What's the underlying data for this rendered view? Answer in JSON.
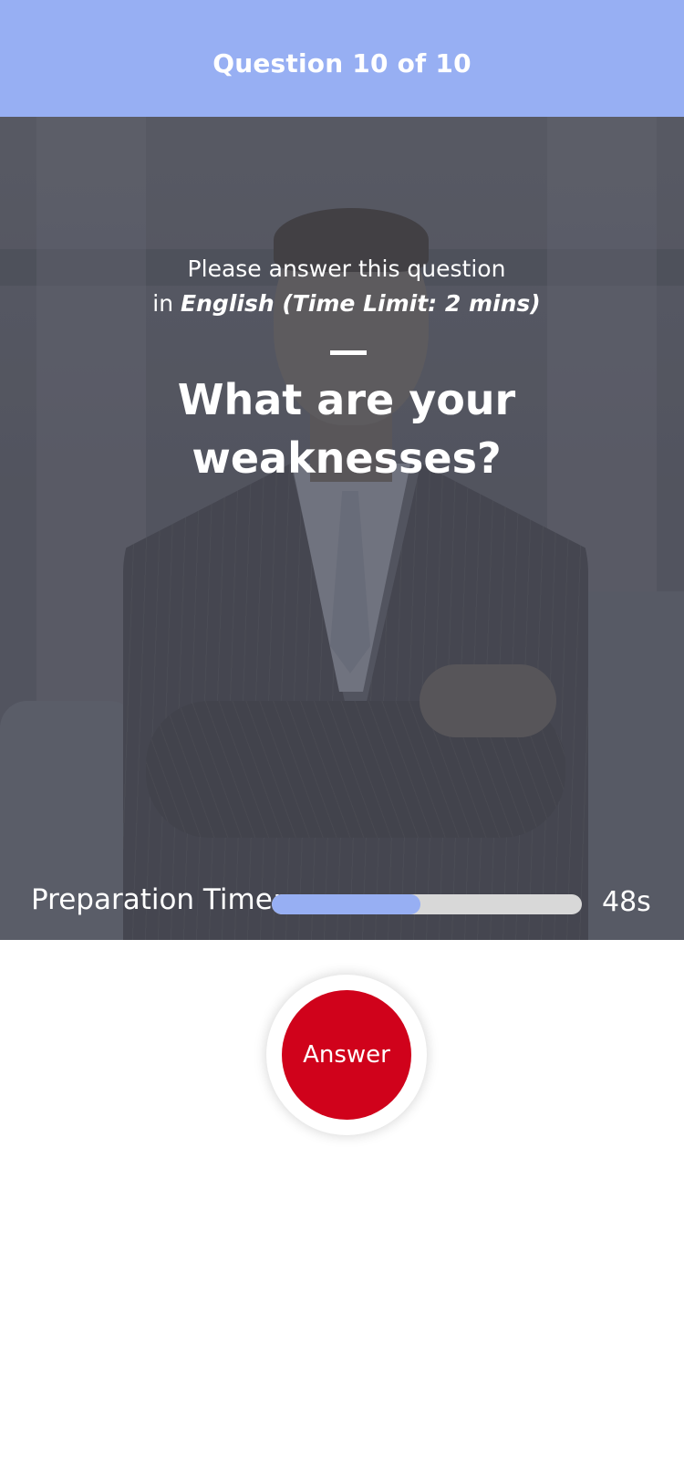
{
  "header": {
    "title": "Question 10 of 10",
    "background_color": "#97aff3"
  },
  "question_panel": {
    "instruction_prefix": "Please answer this question",
    "instruction_in": "in ",
    "instruction_language": "English (Time Limit: 2 mins)",
    "question_text": "What are your weaknesses?"
  },
  "preparation": {
    "label": "Preparation Time:",
    "seconds_text": "48s",
    "progress_fraction": 0.48,
    "fill_color": "#97aff3",
    "track_color": "#d8d8d8"
  },
  "answer_button": {
    "label": "Answer",
    "color": "#d0021b"
  }
}
